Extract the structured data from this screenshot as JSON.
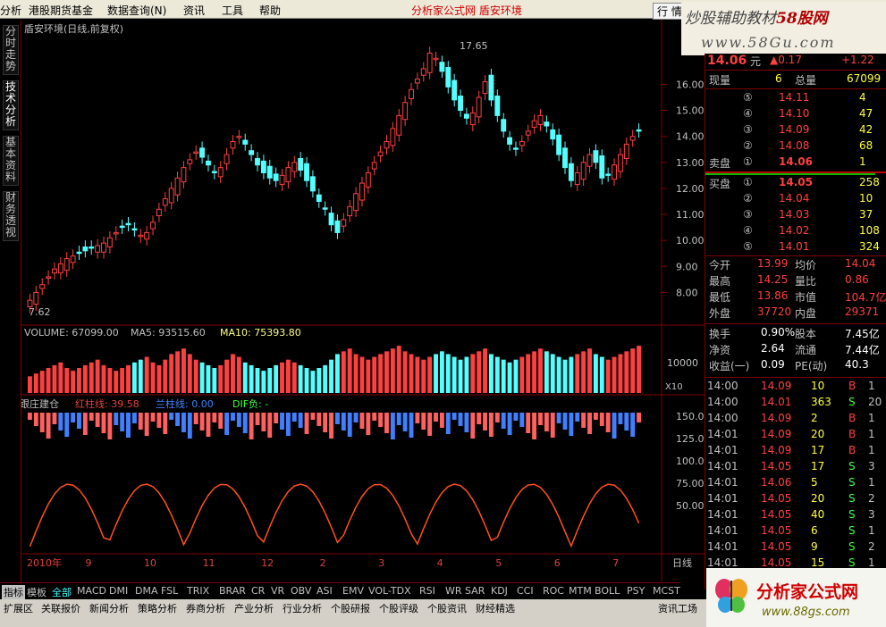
{
  "menu": {
    "items": [
      "分析",
      "港股期货基金",
      "数据查询(N)",
      "资讯",
      "工具",
      "帮助"
    ],
    "center": "分析家公式网 盾安环境",
    "right": "行 情"
  },
  "watermark_top": {
    "line1_a": "炒股辅助教材",
    "line1_b": "58股网",
    "line2": "www.58Gu.com"
  },
  "sidebar": {
    "tabs": [
      "分时走势",
      "技术分析",
      "基本资料",
      "财务透视"
    ]
  },
  "chart": {
    "title": "盾安环境(日线,前复权)",
    "high_label": "17.65",
    "low_label": "7.62",
    "price_ticks": [
      "16.00",
      "15.00",
      "14.00",
      "13.00",
      "12.00",
      "11.00",
      "10.00",
      "9.00",
      "8.00"
    ],
    "volume_label": "VOLUME: 67099.00",
    "ma5_label": "MA5: 93515.60",
    "ma10_label": "MA10: 75393.80",
    "volume_tick": "10000",
    "volume_unit": "X10",
    "ind_name": "跟庄建仓",
    "ind_red": "红柱线: 39.58",
    "ind_blue": "兰柱线: 0.00",
    "ind_dif": "DIF负: -",
    "ind_ticks": [
      "150.0",
      "125.0",
      "100.0",
      "75.00",
      "50.00"
    ],
    "months": [
      "2010年",
      "9",
      "10",
      "11",
      "12",
      "2",
      "3",
      "4",
      "5",
      "6",
      "7"
    ],
    "period": "日线"
  },
  "chart_data": {
    "type": "candlestick",
    "high": 17.65,
    "low": 7.62,
    "ylim": [
      7.5,
      18
    ],
    "close": [
      7.7,
      8.0,
      8.3,
      8.6,
      8.9,
      9.1,
      9.3,
      9.4,
      9.5,
      9.6,
      9.7,
      9.8,
      9.9,
      10.1,
      10.3,
      10.5,
      10.6,
      10.4,
      10.2,
      10.3,
      10.7,
      11.2,
      11.6,
      12.0,
      12.4,
      12.8,
      13.1,
      13.4,
      13.2,
      12.9,
      12.6,
      12.8,
      13.3,
      13.8,
      14.0,
      13.7,
      13.3,
      12.9,
      12.6,
      12.4,
      12.3,
      12.5,
      12.8,
      13.0,
      12.7,
      12.3,
      11.9,
      11.5,
      11.2,
      10.6,
      10.3,
      10.8,
      11.3,
      11.8,
      12.2,
      12.6,
      13.0,
      13.4,
      13.8,
      14.3,
      14.8,
      15.3,
      15.8,
      16.2,
      16.6,
      17.2,
      17.0,
      16.5,
      15.9,
      15.4,
      15.0,
      14.7,
      14.9,
      15.5,
      16.1,
      15.4,
      14.8,
      14.2,
      13.7,
      13.5,
      13.8,
      14.2,
      14.6,
      14.8,
      14.4,
      13.9,
      13.3,
      12.8,
      12.3,
      12.6,
      13.0,
      13.3,
      13.0,
      12.4,
      12.5,
      12.9,
      13.3,
      13.7,
      14.0,
      14.2
    ],
    "volume": [
      6,
      7,
      8,
      9,
      10,
      11,
      9,
      8,
      9,
      10,
      11,
      12,
      10,
      9,
      8,
      9,
      10,
      11,
      12,
      13,
      11,
      10,
      12,
      14,
      15,
      16,
      14,
      12,
      11,
      10,
      9,
      10,
      12,
      14,
      13,
      11,
      10,
      9,
      8,
      9,
      10,
      11,
      12,
      11,
      10,
      9,
      8,
      9,
      10,
      12,
      14,
      15,
      16,
      14,
      13,
      12,
      13,
      14,
      15,
      16,
      17,
      15,
      14,
      13,
      12,
      13,
      14,
      15,
      14,
      13,
      12,
      13,
      14,
      15,
      16,
      14,
      13,
      12,
      11,
      12,
      13,
      14,
      15,
      16,
      15,
      14,
      13,
      12,
      13,
      14,
      15,
      16,
      14,
      13,
      12,
      13,
      14,
      15,
      16,
      17
    ]
  },
  "quote": {
    "price": "14.06",
    "price_unit": "元",
    "change": "▲0.17",
    "change_pct": "+1.22",
    "now_vol_label": "现量",
    "now_vol": "6",
    "total_label": "总量",
    "total": "67099",
    "asks": [
      {
        "n": "⑤",
        "p": "14.11",
        "v": "4"
      },
      {
        "n": "④",
        "p": "14.10",
        "v": "47"
      },
      {
        "n": "③",
        "p": "14.09",
        "v": "42"
      },
      {
        "n": "②",
        "p": "14.08",
        "v": "68"
      },
      {
        "n": "①",
        "p": "14.06",
        "v": "1",
        "label": "卖盘"
      }
    ],
    "bids": [
      {
        "n": "①",
        "p": "14.05",
        "v": "258",
        "label": "买盘"
      },
      {
        "n": "②",
        "p": "14.04",
        "v": "10"
      },
      {
        "n": "③",
        "p": "14.03",
        "v": "37"
      },
      {
        "n": "④",
        "p": "14.02",
        "v": "108"
      },
      {
        "n": "⑤",
        "p": "14.01",
        "v": "324"
      }
    ],
    "stats": [
      [
        "今开",
        "13.99",
        "均价",
        "14.04"
      ],
      [
        "最高",
        "14.25",
        "量比",
        "0.86"
      ],
      [
        "最低",
        "13.86",
        "市值",
        "104.7亿"
      ],
      [
        "外盘",
        "37720",
        "内盘",
        "29371"
      ]
    ],
    "fin": [
      [
        "换手",
        "0.90%",
        "股本",
        "7.45亿"
      ],
      [
        "净资",
        "2.64",
        "流通",
        "7.44亿"
      ],
      [
        "收益(一)",
        "0.09",
        "PE(动)",
        "40.3"
      ]
    ],
    "ticks": [
      [
        "14:00",
        "14.09",
        "10",
        "B",
        "1"
      ],
      [
        "14:00",
        "14.01",
        "363",
        "S",
        "20"
      ],
      [
        "14:00",
        "14.09",
        "2",
        "B",
        "1"
      ],
      [
        "14:01",
        "14.09",
        "20",
        "B",
        "1"
      ],
      [
        "14:01",
        "14.09",
        "17",
        "B",
        "1"
      ],
      [
        "14:01",
        "14.05",
        "17",
        "S",
        "3"
      ],
      [
        "14:01",
        "14.06",
        "5",
        "S",
        "1"
      ],
      [
        "14:01",
        "14.05",
        "20",
        "S",
        "2"
      ],
      [
        "14:01",
        "14.05",
        "40",
        "S",
        "3"
      ],
      [
        "14:01",
        "14.05",
        "6",
        "S",
        "1"
      ],
      [
        "14:01",
        "14.05",
        "9",
        "S",
        "2"
      ],
      [
        "14:01",
        "14.05",
        "15",
        "S",
        "1"
      ]
    ]
  },
  "indicator_tabs": [
    "指标",
    "模板",
    "全部",
    "MACD",
    "DMI",
    "DMA",
    "FSL",
    "TRIX",
    "BRAR",
    "CR",
    "VR",
    "OBV",
    "ASI",
    "EMV",
    "VOL-TDX",
    "RSI",
    "WR",
    "SAR",
    "KDJ",
    "CCI",
    "ROC",
    "MTM",
    "BOLL",
    "PSY",
    "MCST"
  ],
  "bottom_tabs": [
    "扩展区",
    "关联报价",
    "新闻分析",
    "策略分析",
    "券商分析",
    "产业分析",
    "行业分析",
    "个股研报",
    "个股评级",
    "个股资讯",
    "财经精选",
    "资讯工场"
  ],
  "watermark_bottom": {
    "line1": "分析家公式网",
    "line2": "www.88gs.com"
  }
}
